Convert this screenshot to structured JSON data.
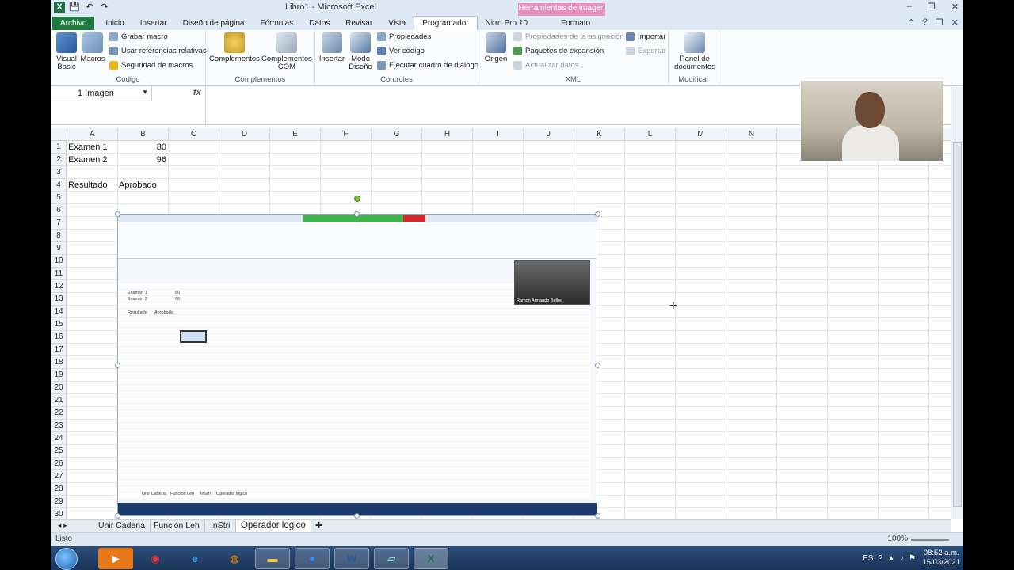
{
  "window": {
    "title": "Libro1 - Microsoft Excel",
    "tools_context": "Herramientas de imagen",
    "controls": [
      "–",
      "❐",
      "✕"
    ]
  },
  "qat": [
    "💾",
    "↶",
    "↷"
  ],
  "tabs": [
    {
      "label": "Archivo"
    },
    {
      "label": "Inicio"
    },
    {
      "label": "Insertar"
    },
    {
      "label": "Diseño de página"
    },
    {
      "label": "Fórmulas"
    },
    {
      "label": "Datos"
    },
    {
      "label": "Revisar"
    },
    {
      "label": "Vista"
    },
    {
      "label": "Programador"
    },
    {
      "label": "Nitro Pro 10"
    },
    {
      "label": "Formato"
    }
  ],
  "ribbon": {
    "codigo": {
      "name": "Código",
      "visual_basic": "Visual Basic",
      "macros": "Macros",
      "grabar_macro": "Grabar macro",
      "usar_referencias": "Usar referencias relativas",
      "seguridad_macros": "Seguridad de macros"
    },
    "complementos": {
      "name": "Complementos",
      "complementos": "Complementos",
      "complementos_com": "Complementos COM"
    },
    "controles": {
      "name": "Controles",
      "insertar": "Insertar",
      "modo_diseno": "Modo Diseño",
      "propiedades": "Propiedades",
      "ver_codigo": "Ver código",
      "ejecutar_cuadro": "Ejecutar cuadro de diálogo"
    },
    "xml": {
      "name": "XML",
      "origen": "Origen",
      "propiedades_asignacion": "Propiedades de la asignación",
      "paquetes_expansion": "Paquetes de expansión",
      "actualizar_datos": "Actualizar datos",
      "importar": "Importar",
      "exportar": "Exportar"
    },
    "modificar": {
      "name": "Modificar",
      "panel_documentos": "Panel de documentos"
    }
  },
  "formula_bar": {
    "name_box": "1 Imagen",
    "fx": "fx",
    "formula": ""
  },
  "columns": [
    "A",
    "B",
    "C",
    "D",
    "E",
    "F",
    "G",
    "H",
    "I",
    "J",
    "K",
    "L",
    "M",
    "N"
  ],
  "rows": [
    "1",
    "2",
    "3",
    "4",
    "5",
    "6",
    "7",
    "8",
    "9",
    "10",
    "11",
    "12",
    "13",
    "14",
    "15",
    "16",
    "17",
    "18",
    "19",
    "20",
    "21",
    "22",
    "23",
    "24",
    "25",
    "26",
    "27",
    "28",
    "29",
    "30"
  ],
  "cells": {
    "A1": "Examen 1",
    "B1": "80",
    "A2": "Examen 2",
    "B2": "96",
    "A4": "Resultado",
    "B4": "Aprobado"
  },
  "embedded_image": {
    "cells_a1": "Examen 1",
    "cells_b1": "80",
    "cells_a2": "Examen 2",
    "cells_b2": "96",
    "cells_a4": "Resultado",
    "cells_b4": "Aprobado",
    "cam_label": "Ramon Armando Bethel",
    "sheet_tabs": [
      "Unir Cadena",
      "Funcion Len",
      "InStri",
      "Operador logico"
    ]
  },
  "sheet_tabs": [
    "Unir Cadena",
    "Funcion Len",
    "InStri",
    "Operador logico"
  ],
  "active_sheet": "Operador logico",
  "status": {
    "ready": "Listo",
    "zoom": "100%"
  },
  "taskbar": {
    "apps": [
      "explorer-icon",
      "media-icon",
      "chrome-icon",
      "ie-icon",
      "firefox-icon",
      "folder-icon",
      "zoom-icon",
      "word-icon",
      "notepad-icon",
      "excel-icon"
    ],
    "language": "ES",
    "time": "08:52 a.m.",
    "date": "15/03/2021"
  }
}
